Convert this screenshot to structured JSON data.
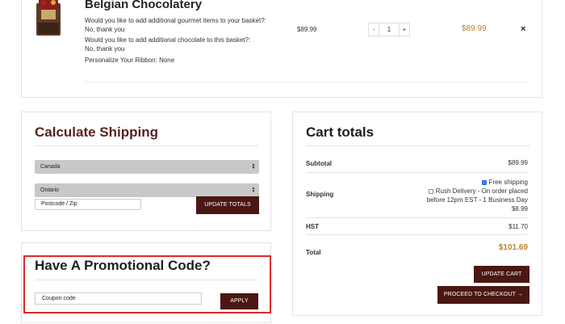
{
  "cart_item": {
    "product_name": "Belgian Chocolatery",
    "question1": "Would you like to add additional gourmet items to your basket?:",
    "answer1": "No, thank you",
    "question2": "Would you like to add additional chocolate to this basket?:",
    "answer2": "No, thank you",
    "ribbon": "Personalize Your Ribbon: None",
    "price": "$89.99",
    "qty_minus": "-",
    "quantity": "1",
    "qty_plus": "+",
    "subtotal": "$89.99",
    "remove": "×"
  },
  "shipping": {
    "title": "Calculate Shipping",
    "country": "Canada",
    "province": "Ontario",
    "postcode_placeholder": "Postcode / Zip",
    "update_button": "UPDATE TOTALS",
    "select_arrows": "▲▼"
  },
  "promo": {
    "title": "Have A Promotional Code?",
    "coupon_placeholder": "Coupon code",
    "apply_button": "APPLY"
  },
  "totals": {
    "title": "Cart totals",
    "subtotal_label": "Subtotal",
    "subtotal_value": "$89.99",
    "shipping_label": "Shipping",
    "free_shipping": "Free shipping",
    "rush_line1": "Rush Delivery - On order placed",
    "rush_line2": "before 12pm EST - 1 Business Day",
    "rush_price": "$8.99",
    "hst_label": "HST",
    "hst_value": "$11.70",
    "total_label": "Total",
    "total_value": "$101.69",
    "update_cart_button": "UPDATE CART",
    "checkout_button": "PROCEED TO CHECKOUT →"
  },
  "colors": {
    "accent_dark": "#4a1712",
    "price_gold": "#b6862c",
    "highlight_red": "#e0292b",
    "title_maroon": "#5a1f1f"
  }
}
